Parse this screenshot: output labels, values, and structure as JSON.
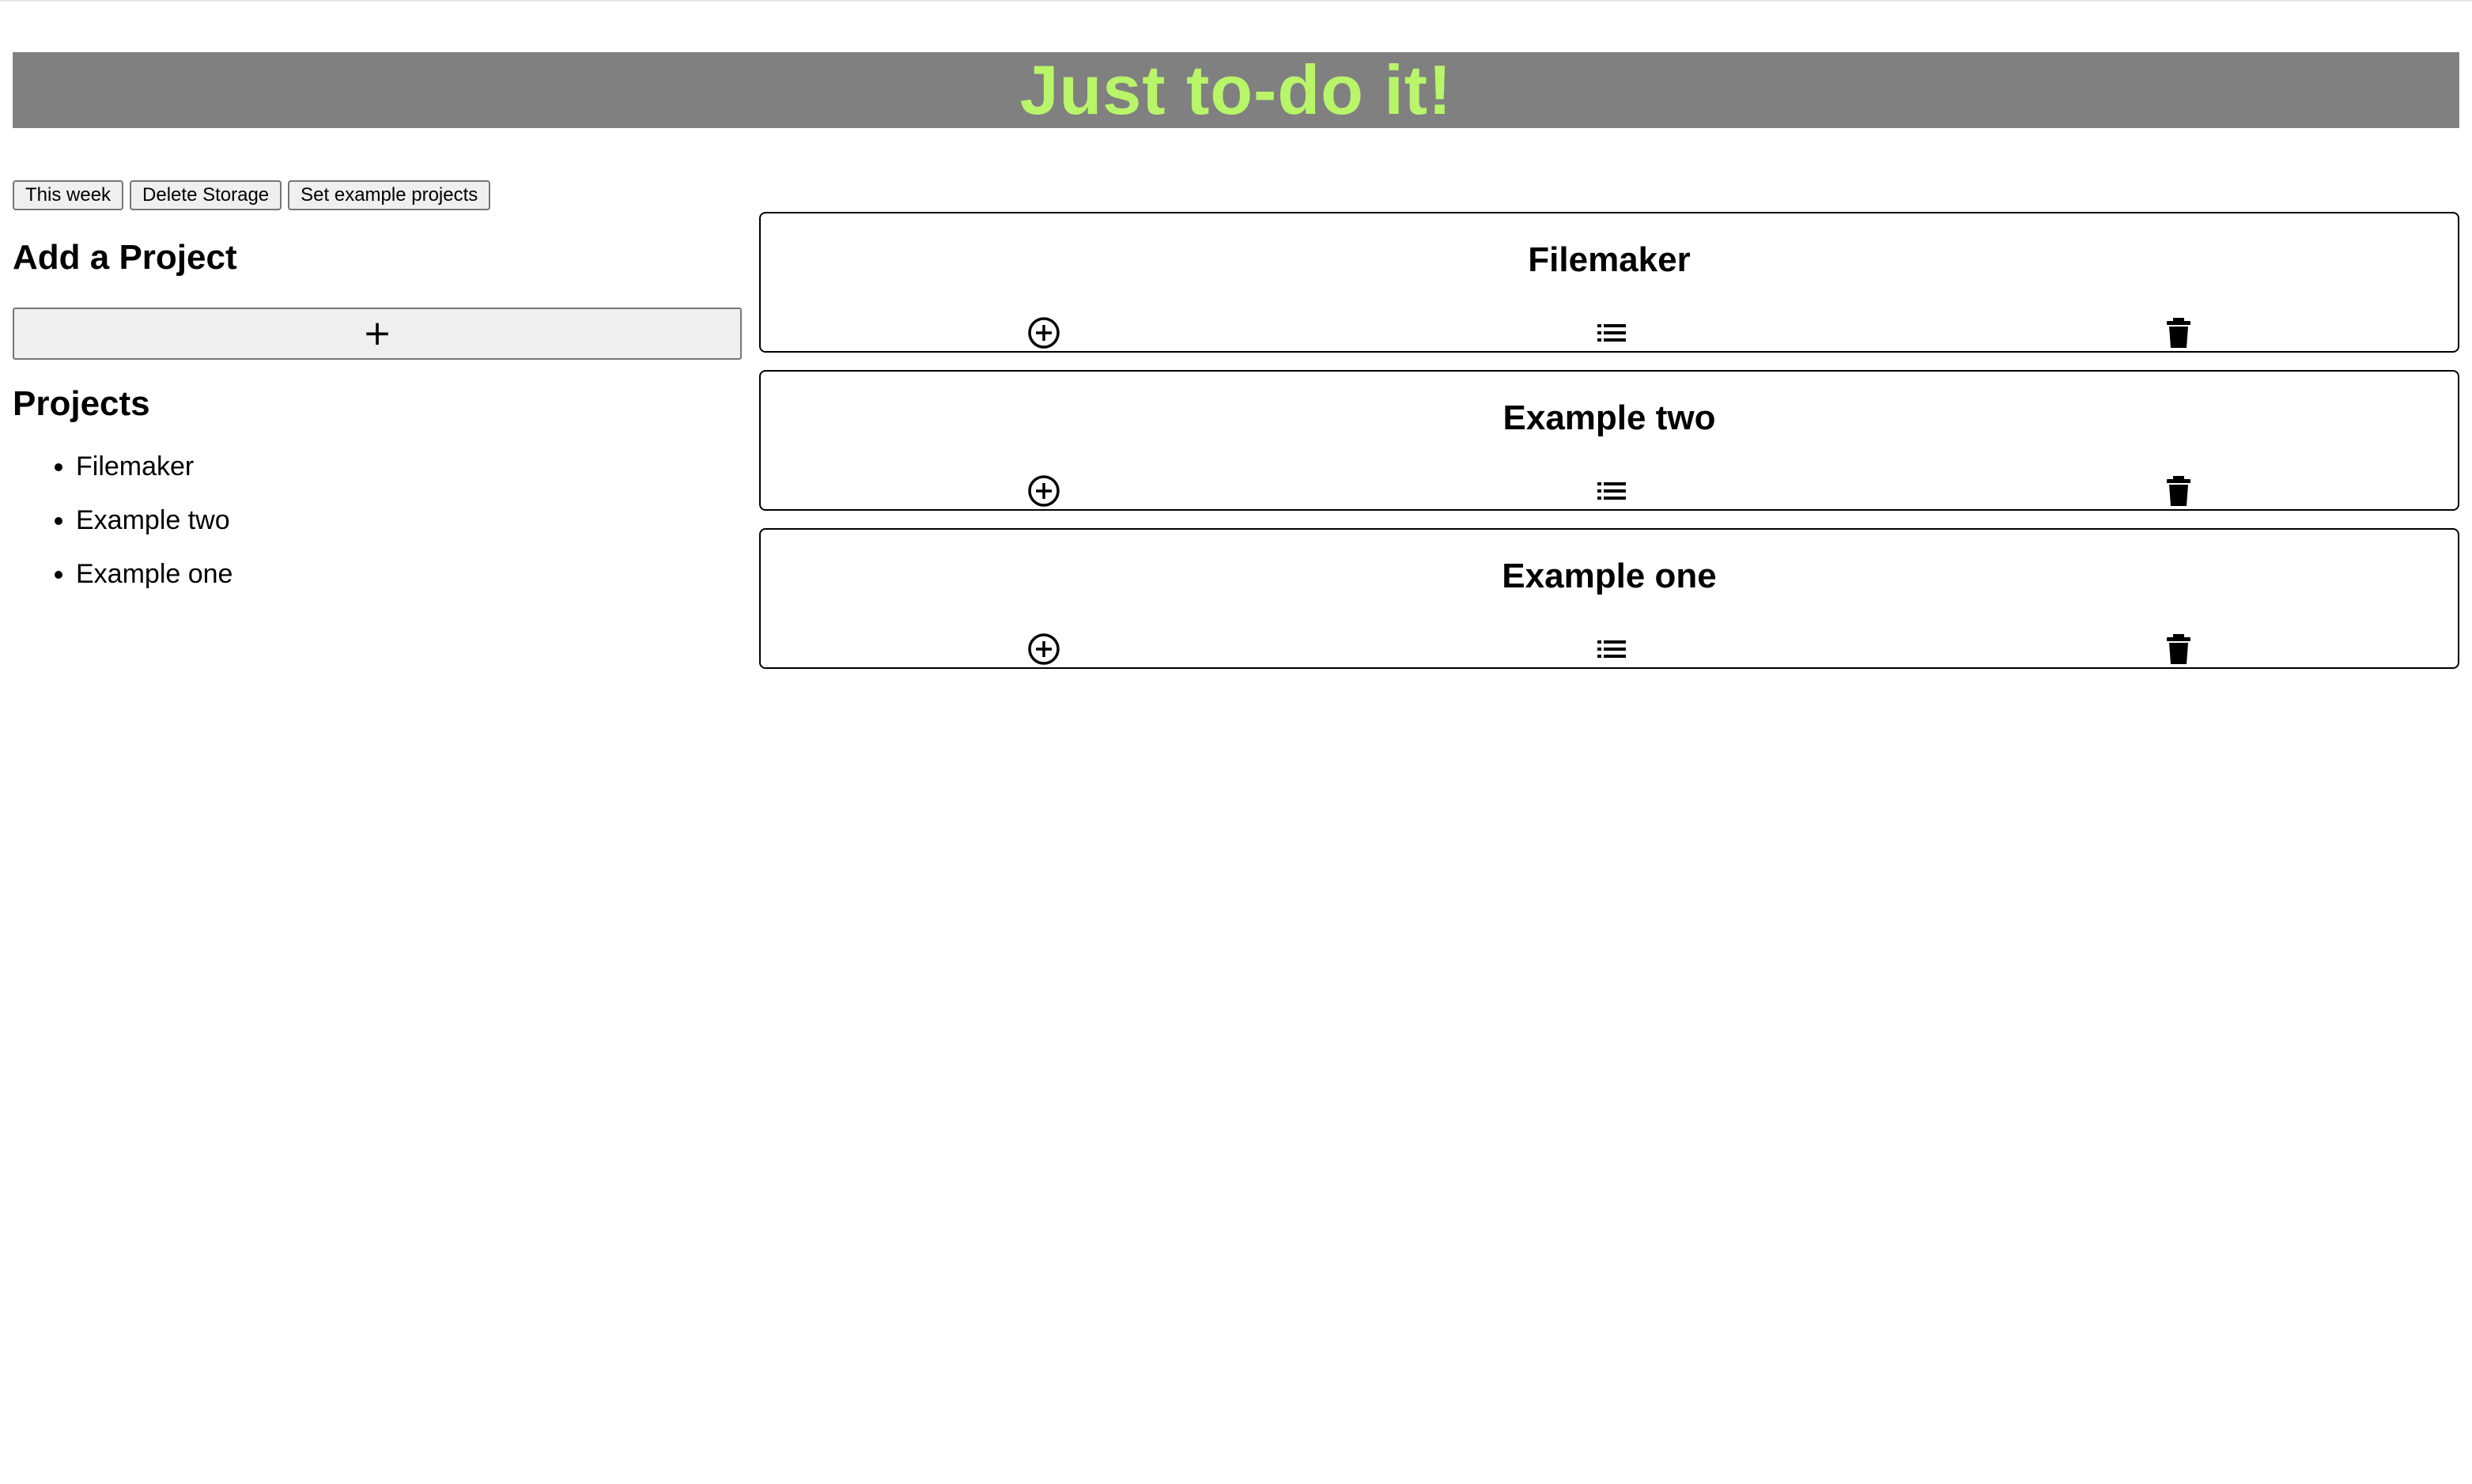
{
  "header": {
    "title": "Just to-do it!",
    "title_color": "#b8f569",
    "background": "#808080"
  },
  "toolbar": {
    "this_week_label": "This week",
    "delete_storage_label": "Delete Storage",
    "set_example_label": "Set example projects"
  },
  "sidebar": {
    "add_project_title": "Add a Project",
    "add_button_label": "+",
    "projects_title": "Projects",
    "projects": [
      "Filemaker",
      "Example two",
      "Example one"
    ]
  },
  "cards": [
    {
      "title": "Filemaker",
      "icons": [
        "add-circle-icon",
        "list-icon",
        "trash-icon"
      ]
    },
    {
      "title": "Example two",
      "icons": [
        "add-circle-icon",
        "list-icon",
        "trash-icon"
      ]
    },
    {
      "title": "Example one",
      "icons": [
        "add-circle-icon",
        "list-icon",
        "trash-icon"
      ]
    }
  ]
}
